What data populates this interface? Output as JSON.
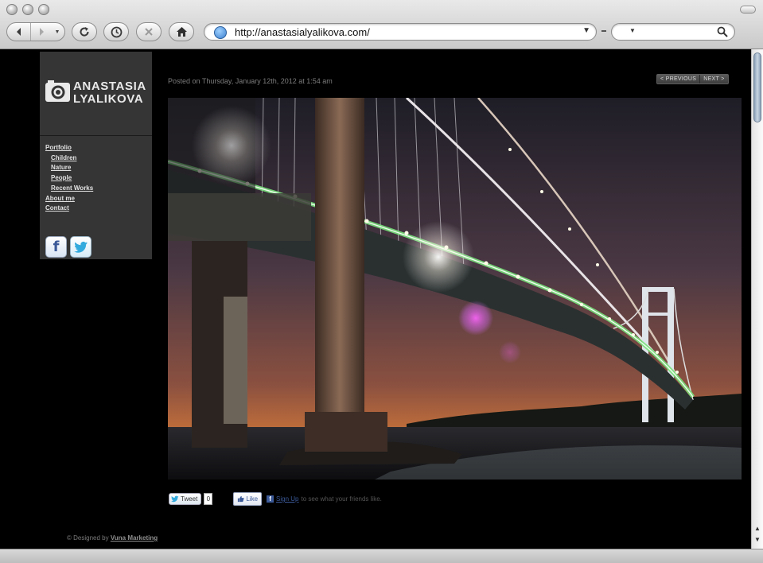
{
  "browser": {
    "url": "http://anastasialyalikova.com/",
    "search_placeholder": ""
  },
  "site": {
    "logo_line1": "ANASTASIA",
    "logo_line2": "LYALIKOVA",
    "nav": [
      {
        "label": "Portfolio",
        "level": 0
      },
      {
        "label": "Children",
        "level": 1
      },
      {
        "label": "Nature",
        "level": 1
      },
      {
        "label": "People",
        "level": 1
      },
      {
        "label": "Recent Works",
        "level": 1
      },
      {
        "label": "About me",
        "level": 0
      },
      {
        "label": "Contact",
        "level": 0
      }
    ],
    "social": {
      "facebook_glyph": "f",
      "twitter_glyph": "t"
    }
  },
  "post": {
    "posted_on": "Posted on Thursday, January 12th, 2012 at 1:54 am",
    "prev_label": "< PREVIOUS",
    "next_label": "NEXT >"
  },
  "share": {
    "tweet_label": "Tweet",
    "tweet_count": "0",
    "like_label": "Like",
    "signup_label": "Sign Up",
    "friends_text": "to see what your friends like."
  },
  "footer": {
    "prefix": "© Designed by",
    "link": "Vuna Marketing"
  },
  "colors": {
    "page_bg": "#000000",
    "sidebar_bg": "#353535",
    "facebook_blue": "#3b5998"
  }
}
